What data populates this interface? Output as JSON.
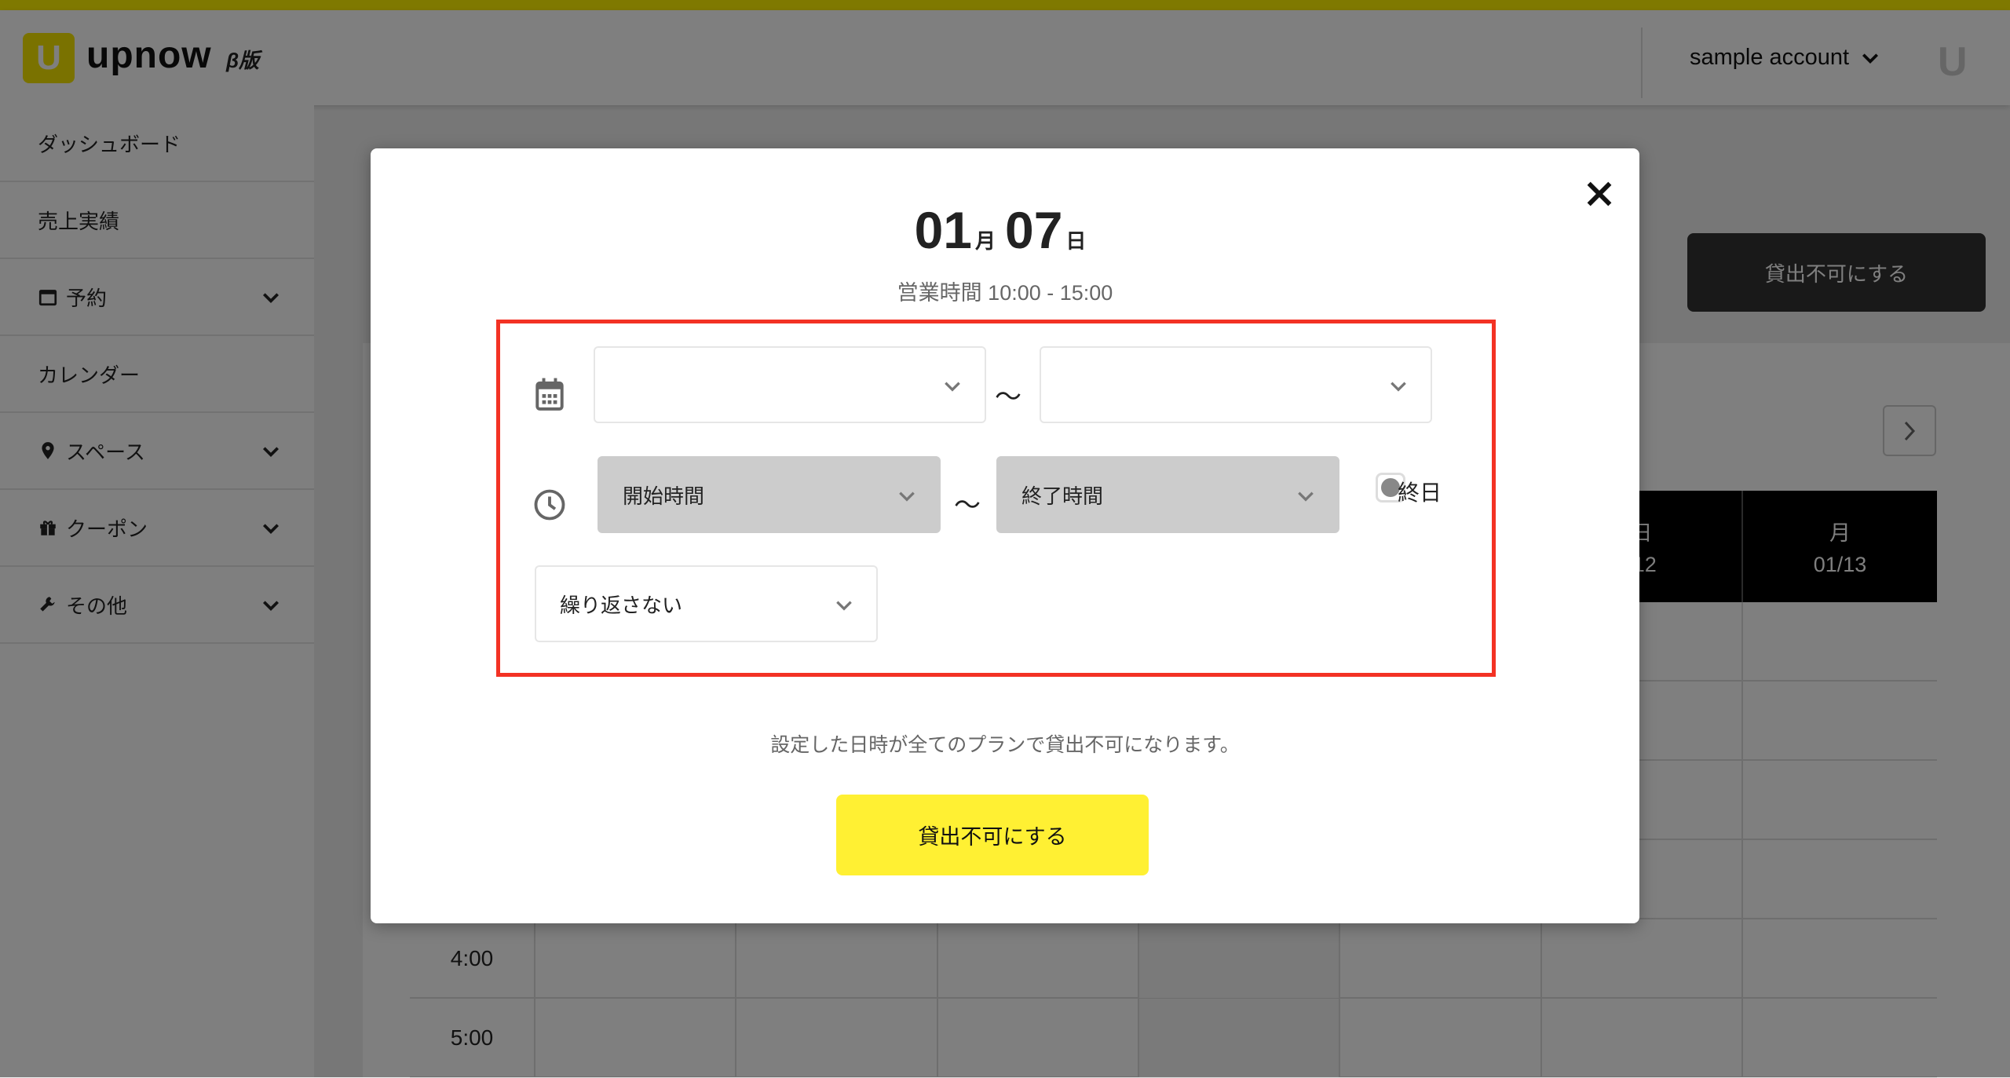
{
  "brand": {
    "name": "upnow",
    "beta": "β版",
    "accent": "#fff200"
  },
  "header": {
    "account": "sample account"
  },
  "sidebar": {
    "items": [
      {
        "label": "ダッシュボード",
        "icon": "",
        "expandable": false
      },
      {
        "label": "売上実績",
        "icon": "",
        "expandable": false
      },
      {
        "label": "予約",
        "icon": "calendar-icon",
        "expandable": true
      },
      {
        "label": "カレンダー",
        "icon": "",
        "expandable": false
      },
      {
        "label": "スペース",
        "icon": "map-pin-icon",
        "expandable": true
      },
      {
        "label": "クーポン",
        "icon": "gift-icon",
        "expandable": true
      },
      {
        "label": "その他",
        "icon": "wrench-icon",
        "expandable": true
      }
    ]
  },
  "main": {
    "block_button": "貸出不可にする",
    "calendar": {
      "headers": [
        {
          "day": "日",
          "date": "/12"
        },
        {
          "day": "月",
          "date": "01/13"
        }
      ],
      "times": [
        "",
        "",
        "",
        "",
        "4:00",
        "5:00"
      ]
    }
  },
  "modal": {
    "month": "01",
    "month_unit": "月",
    "day": "07",
    "day_unit": "日",
    "hours": "営業時間 10:00 - 15:00",
    "date_from": "",
    "date_to": "",
    "tilde": "～",
    "start_time": "開始時間",
    "end_time": "終了時間",
    "all_day": "終日",
    "repeat": "繰り返さない",
    "note": "設定した日時が全てのプランで貸出不可になります。",
    "submit": "貸出不可にする",
    "highlight_color": "#f33224",
    "button_color": "#fff033"
  }
}
